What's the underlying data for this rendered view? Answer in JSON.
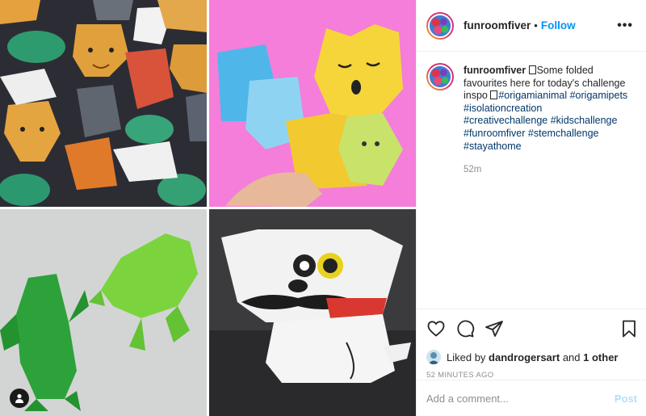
{
  "post": {
    "username": "funroomfiver",
    "separator": "•",
    "follow_label": "Follow",
    "more_label": "•••",
    "caption": {
      "username": "funroomfiver",
      "text_before": "Some folded favourites here for today's challenge inspo ",
      "hashtags": [
        "#origamianimal",
        "#origamipets",
        "#isolationcreation",
        "#creativechallenge",
        "#kidschallenge",
        "#funroomfiver",
        "#stemchallenge",
        "#stayathome"
      ],
      "age": "52m"
    },
    "likes": {
      "prefix": "Liked by ",
      "liker": "dandrogersart",
      "suffix": " and ",
      "others": "1 other"
    },
    "timestamp": "52 minutes ago",
    "comment": {
      "placeholder": "Add a comment...",
      "value": "",
      "post_label": "Post"
    }
  },
  "media": {
    "tiles": [
      {
        "subject": "origami animal faces on dark background"
      },
      {
        "subject": "yellow origami bear on pink background"
      },
      {
        "subject": "green origami frogs"
      },
      {
        "subject": "origami pug with moustache and monocle"
      }
    ]
  },
  "icons": {
    "like": "heart-icon",
    "comment": "comment-bubble-icon",
    "share": "paper-plane-icon",
    "save": "bookmark-icon",
    "tag": "user-tag-icon"
  },
  "colors": {
    "link_blue": "#0095f6",
    "hashtag": "#00376b",
    "muted": "#8e8e8e",
    "post_disabled": "#b2dffc"
  }
}
